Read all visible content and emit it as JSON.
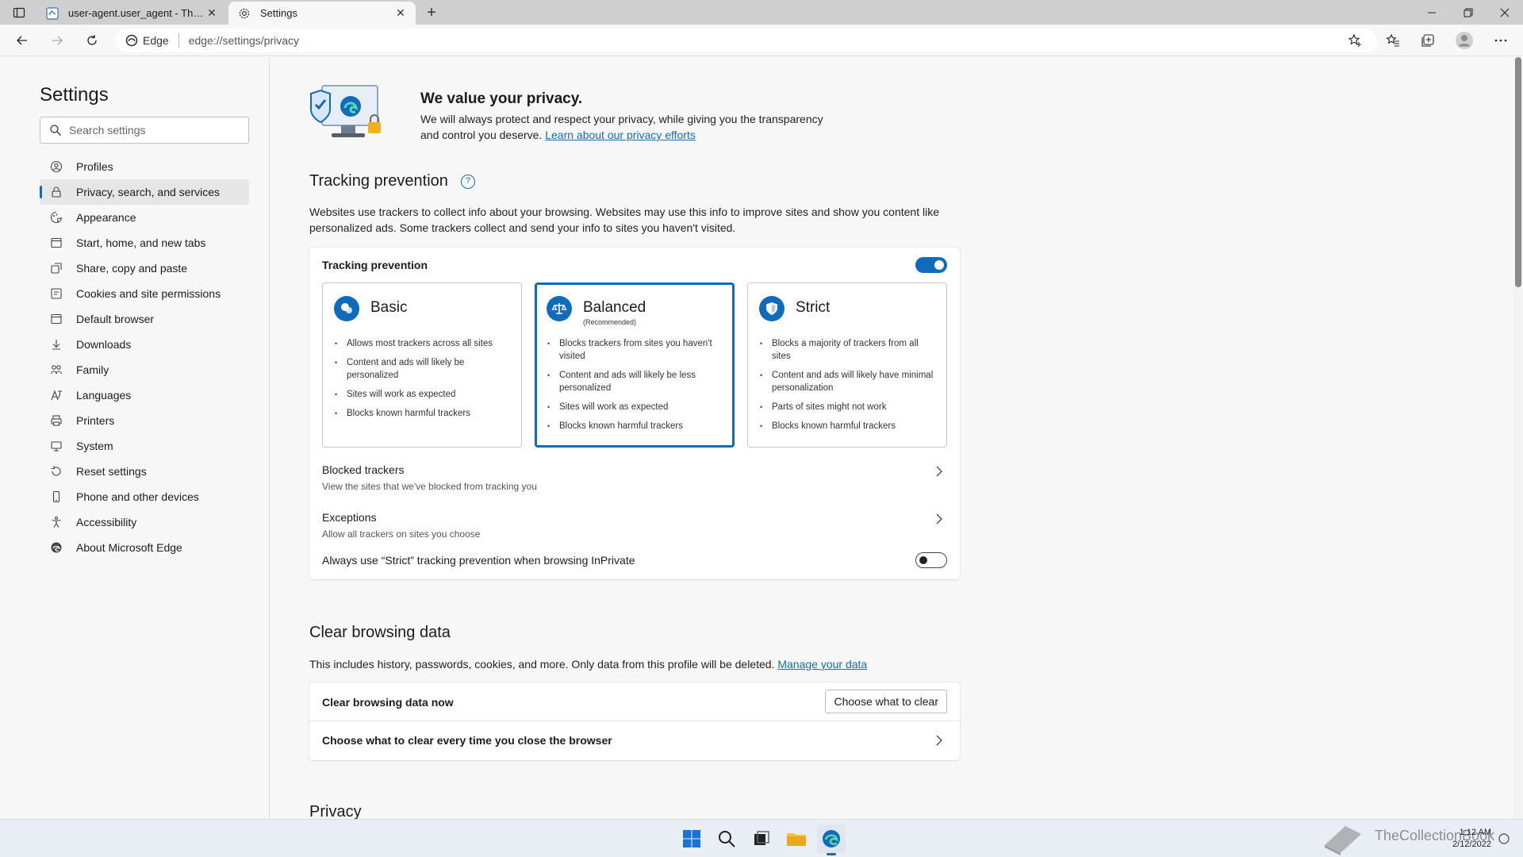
{
  "browser": {
    "tabs": [
      {
        "title": "user-agent.user_agent - The Coll",
        "active": false
      },
      {
        "title": "Settings",
        "active": true
      }
    ],
    "address": {
      "site_label": "Edge",
      "url": "edge://settings/privacy"
    }
  },
  "sidebar": {
    "title": "Settings",
    "search_placeholder": "Search settings",
    "items": [
      {
        "label": "Profiles",
        "icon": "profile-icon"
      },
      {
        "label": "Privacy, search, and services",
        "icon": "lock-icon"
      },
      {
        "label": "Appearance",
        "icon": "appearance-icon"
      },
      {
        "label": "Start, home, and new tabs",
        "icon": "home-tabs-icon"
      },
      {
        "label": "Share, copy and paste",
        "icon": "share-icon"
      },
      {
        "label": "Cookies and site permissions",
        "icon": "cookies-icon"
      },
      {
        "label": "Default browser",
        "icon": "browser-icon"
      },
      {
        "label": "Downloads",
        "icon": "download-icon"
      },
      {
        "label": "Family",
        "icon": "family-icon"
      },
      {
        "label": "Languages",
        "icon": "language-icon"
      },
      {
        "label": "Printers",
        "icon": "printer-icon"
      },
      {
        "label": "System",
        "icon": "system-icon"
      },
      {
        "label": "Reset settings",
        "icon": "reset-icon"
      },
      {
        "label": "Phone and other devices",
        "icon": "phone-icon"
      },
      {
        "label": "Accessibility",
        "icon": "accessibility-icon"
      },
      {
        "label": "About Microsoft Edge",
        "icon": "edge-icon"
      }
    ]
  },
  "hero": {
    "title": "We value your privacy.",
    "text": "We will always protect and respect your privacy, while giving you the transparency and control you deserve.",
    "link": "Learn about our privacy efforts"
  },
  "tracking": {
    "section_title": "Tracking prevention",
    "description": "Websites use trackers to collect info about your browsing. Websites may use this info to improve sites and show you content like personalized ads. Some trackers collect and send your info to sites you haven't visited.",
    "toggle_label": "Tracking prevention",
    "enabled": true,
    "options": [
      {
        "name": "Basic",
        "note": "",
        "bullets": [
          "Allows most trackers across all sites",
          "Content and ads will likely be personalized",
          "Sites will work as expected",
          "Blocks known harmful trackers"
        ]
      },
      {
        "name": "Balanced",
        "note": "(Recommended)",
        "bullets": [
          "Blocks trackers from sites you haven't visited",
          "Content and ads will likely be less personalized",
          "Sites will work as expected",
          "Blocks known harmful trackers"
        ]
      },
      {
        "name": "Strict",
        "note": "",
        "bullets": [
          "Blocks a majority of trackers from all sites",
          "Content and ads will likely have minimal personalization",
          "Parts of sites might not work",
          "Blocks known harmful trackers"
        ]
      }
    ],
    "selected": "Balanced",
    "blocked": {
      "title": "Blocked trackers",
      "sub": "View the sites that we've blocked from tracking you"
    },
    "exceptions": {
      "title": "Exceptions",
      "sub": "Allow all trackers on sites you choose"
    },
    "inprivate": {
      "title": "Always use “Strict” tracking prevention when browsing InPrivate",
      "enabled": false
    }
  },
  "clear": {
    "section_title": "Clear browsing data",
    "description": "This includes history, passwords, cookies, and more. Only data from this profile will be deleted.",
    "link": "Manage your data",
    "now_label": "Clear browsing data now",
    "button": "Choose what to clear",
    "on_close": "Choose what to clear every time you close the browser"
  },
  "next_section": "Privacy",
  "taskbar": {
    "time": "1:12 AM",
    "date": "2/12/2022",
    "watermark": "TheCollectionBook"
  },
  "colors": {
    "accent": "#0f6cbd"
  }
}
